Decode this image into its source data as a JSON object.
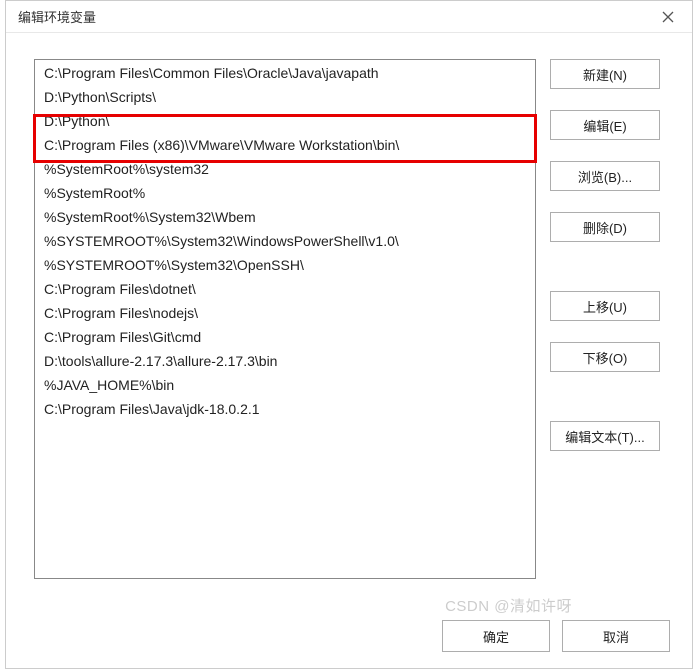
{
  "dialog": {
    "title": "编辑环境变量"
  },
  "entries": [
    "C:\\Program Files\\Common Files\\Oracle\\Java\\javapath",
    "D:\\Python\\Scripts\\",
    "D:\\Python\\",
    "C:\\Program Files (x86)\\VMware\\VMware Workstation\\bin\\",
    "%SystemRoot%\\system32",
    "%SystemRoot%",
    "%SystemRoot%\\System32\\Wbem",
    "%SYSTEMROOT%\\System32\\WindowsPowerShell\\v1.0\\",
    "%SYSTEMROOT%\\System32\\OpenSSH\\",
    "C:\\Program Files\\dotnet\\",
    "C:\\Program Files\\nodejs\\",
    "C:\\Program Files\\Git\\cmd",
    "D:\\tools\\allure-2.17.3\\allure-2.17.3\\bin",
    "%JAVA_HOME%\\bin",
    "C:\\Program Files\\Java\\jdk-18.0.2.1"
  ],
  "buttons": {
    "new": "新建(N)",
    "edit": "编辑(E)",
    "browse": "浏览(B)...",
    "delete": "删除(D)",
    "moveUp": "上移(U)",
    "moveDown": "下移(O)",
    "editText": "编辑文本(T)...",
    "ok": "确定",
    "cancel": "取消"
  },
  "watermark": "CSDN @清如许呀"
}
